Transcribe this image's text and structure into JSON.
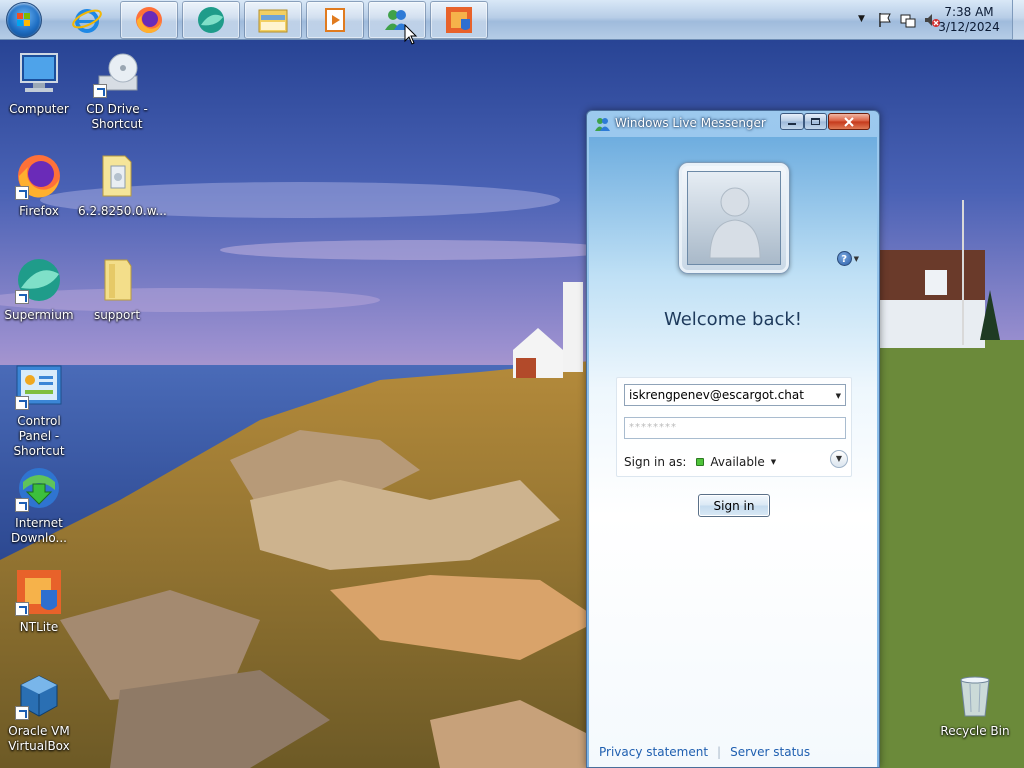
{
  "taskbar": {
    "apps": [
      {
        "name": "Internet Explorer",
        "icon": "internet-explorer-icon"
      },
      {
        "name": "Firefox",
        "icon": "firefox-icon"
      },
      {
        "name": "Supermium",
        "icon": "supermium-icon"
      },
      {
        "name": "Windows Explorer",
        "icon": "folder-icon"
      },
      {
        "name": "Media Player",
        "icon": "media-player-icon"
      },
      {
        "name": "Windows Live Messenger",
        "icon": "messenger-icon"
      },
      {
        "name": "NTLite",
        "icon": "ntlite-icon"
      }
    ],
    "clock": {
      "time": "7:38 AM",
      "date": "3/12/2024"
    }
  },
  "desktop": {
    "icons": [
      {
        "label": "Computer",
        "icon": "computer-icon"
      },
      {
        "label": "CD Drive - Shortcut",
        "icon": "cd-drive-icon"
      },
      {
        "label": "Firefox",
        "icon": "firefox-icon"
      },
      {
        "label": "6.2.8250.0.w...",
        "icon": "folder-icon"
      },
      {
        "label": "Supermium",
        "icon": "supermium-icon"
      },
      {
        "label": "support",
        "icon": "folder-icon"
      },
      {
        "label": "Control Panel - Shortcut",
        "icon": "control-panel-icon"
      },
      {
        "label": "Internet Downlo...",
        "icon": "download-manager-icon"
      },
      {
        "label": "NTLite",
        "icon": "ntlite-icon"
      },
      {
        "label": "Oracle VM VirtualBox",
        "icon": "virtualbox-icon"
      },
      {
        "label": "Recycle Bin",
        "icon": "recycle-bin-icon"
      }
    ]
  },
  "messenger": {
    "title": "Windows Live Messenger",
    "welcome": "Welcome back!",
    "email": "iskrengpenev@escargot.chat",
    "password_mask": "********",
    "sign_in_as_label": "Sign in as:",
    "status": "Available",
    "status_color": "#4fc33a",
    "sign_in_button": "Sign in",
    "help_symbol": "?",
    "links": {
      "privacy": "Privacy statement",
      "server_status": "Server status"
    }
  }
}
